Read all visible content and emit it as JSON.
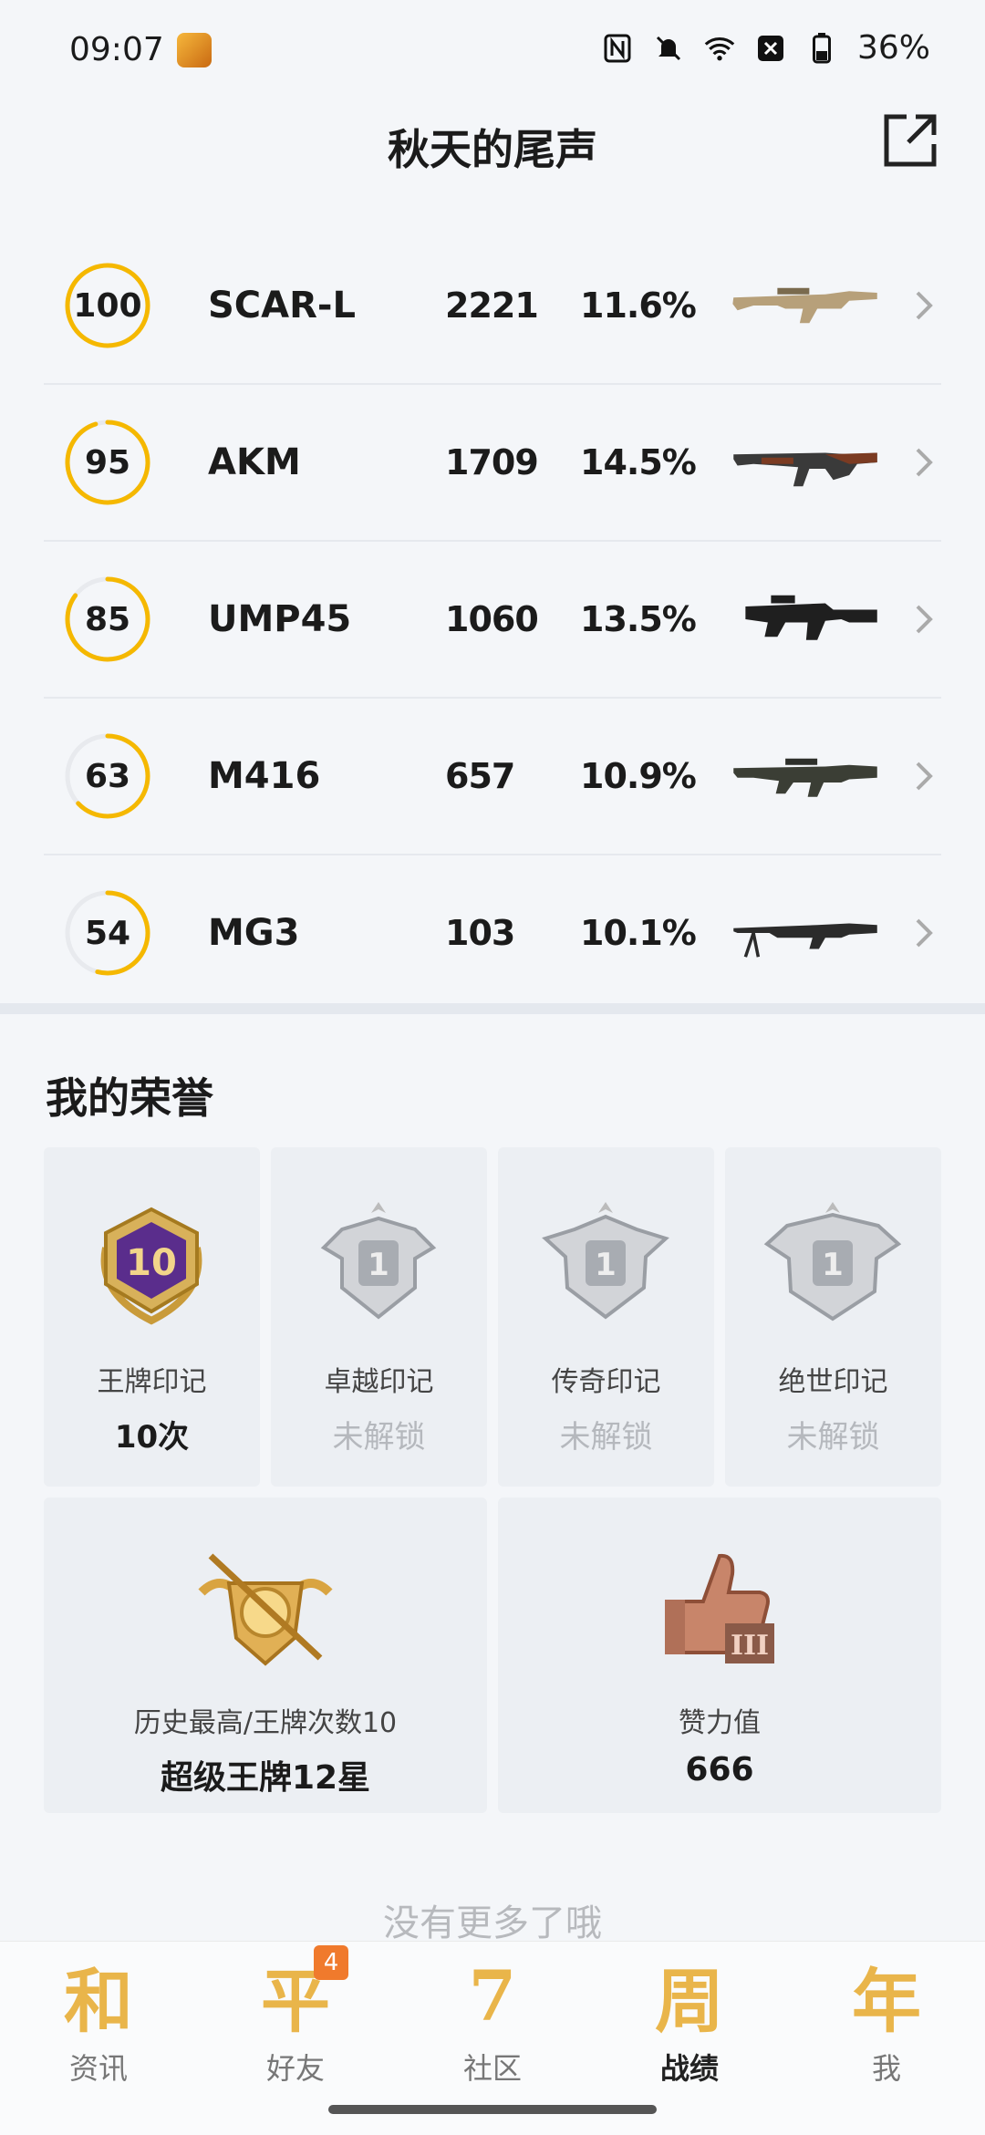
{
  "status_bar": {
    "time": "09:07",
    "battery": "36%"
  },
  "header": {
    "title": "秋天的尾声"
  },
  "weapons": [
    {
      "score": "100",
      "score_value": 100,
      "name": "SCAR-L",
      "count": "2221",
      "rate": "11.6%"
    },
    {
      "score": "95",
      "score_value": 95,
      "name": "AKM",
      "count": "1709",
      "rate": "14.5%"
    },
    {
      "score": "85",
      "score_value": 85,
      "name": "UMP45",
      "count": "1060",
      "rate": "13.5%"
    },
    {
      "score": "63",
      "score_value": 63,
      "name": "M416",
      "count": "657",
      "rate": "10.9%"
    },
    {
      "score": "54",
      "score_value": 54,
      "name": "MG3",
      "count": "103",
      "rate": "10.1%"
    }
  ],
  "honor": {
    "title": "我的荣誉",
    "medals": [
      {
        "label": "王牌印记",
        "value": "10次",
        "locked": false
      },
      {
        "label": "卓越印记",
        "value": "未解锁",
        "locked": true
      },
      {
        "label": "传奇印记",
        "value": "未解锁",
        "locked": true
      },
      {
        "label": "绝世印记",
        "value": "未解锁",
        "locked": true
      }
    ],
    "rank": {
      "label": "历史最高/王牌次数10",
      "value": "超级王牌12星"
    },
    "likes": {
      "label": "赞力值",
      "value": "666"
    }
  },
  "footer_text": "没有更多了哦",
  "nav": {
    "items": [
      {
        "label": "资讯",
        "glyph": "和"
      },
      {
        "label": "好友",
        "glyph": "平",
        "badge": "4"
      },
      {
        "label": "社区",
        "glyph": "7"
      },
      {
        "label": "战绩",
        "glyph": "周",
        "active": true
      },
      {
        "label": "我",
        "glyph": "年"
      }
    ]
  },
  "colors": {
    "accent": "#f5b800",
    "ring_track": "#e8eaee"
  }
}
